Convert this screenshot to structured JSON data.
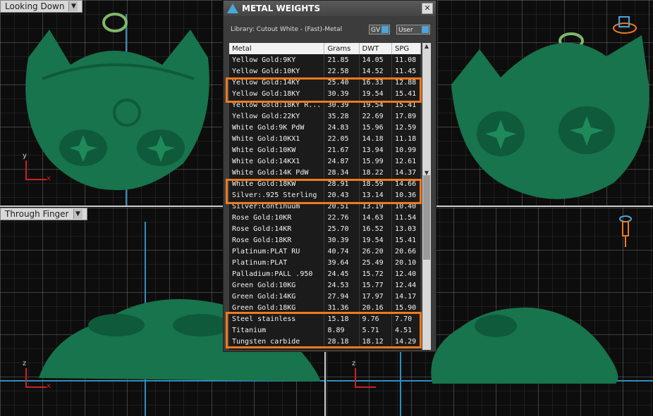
{
  "viewports": {
    "top_left": {
      "label": "Looking Down"
    },
    "bottom_left": {
      "label": "Through Finger"
    }
  },
  "panel": {
    "title": "METAL WEIGHTS",
    "library_label": "Library: Cutout White - (Fast)-Metal",
    "gv_label": "GV",
    "user_label": "User",
    "close_glyph": "✕"
  },
  "table": {
    "headers": [
      "Metal",
      "Grams",
      "DWT",
      "SPG"
    ],
    "rows": [
      [
        "Yellow Gold:9KY",
        "21.85",
        "14.05",
        "11.08"
      ],
      [
        "Yellow Gold:10KY",
        "22.58",
        "14.52",
        "11.45"
      ],
      [
        "Yellow Gold:14KY",
        "25.40",
        "16.33",
        "12.88"
      ],
      [
        "Yellow Gold:18KY",
        "30.39",
        "19.54",
        "15.41"
      ],
      [
        "Yellow Gold:18KY R...",
        "30.39",
        "19.54",
        "15.41"
      ],
      [
        "Yellow Gold:22KY",
        "35.28",
        "22.69",
        "17.89"
      ],
      [
        "White Gold:9K PdW",
        "24.83",
        "15.96",
        "12.59"
      ],
      [
        "White Gold:10KX1",
        "22.05",
        "14.18",
        "11.18"
      ],
      [
        "White Gold:10KW",
        "21.67",
        "13.94",
        "10.99"
      ],
      [
        "White Gold:14KX1",
        "24.87",
        "15.99",
        "12.61"
      ],
      [
        "White Gold:14K PdW",
        "28.34",
        "18.22",
        "14.37"
      ],
      [
        "White Gold:18KW",
        "28.91",
        "18.59",
        "14.66"
      ],
      [
        "Silver:.925 Sterling",
        "20.43",
        "13.14",
        "10.36"
      ],
      [
        "Silver:Continuum",
        "20.51",
        "13.19",
        "10.40"
      ],
      [
        "Rose Gold:10KR",
        "22.76",
        "14.63",
        "11.54"
      ],
      [
        "Rose Gold:14KR",
        "25.70",
        "16.52",
        "13.03"
      ],
      [
        "Rose Gold:18KR",
        "30.39",
        "19.54",
        "15.41"
      ],
      [
        "Platinum:PLAT RU",
        "40.74",
        "26.20",
        "20.66"
      ],
      [
        "Platinum:PLAT",
        "39.64",
        "25.49",
        "20.10"
      ],
      [
        "Palladium:PALL .950",
        "24.45",
        "15.72",
        "12.40"
      ],
      [
        "Green Gold:10KG",
        "24.53",
        "15.77",
        "12.44"
      ],
      [
        "Green Gold:14KG",
        "27.94",
        "17.97",
        "14.17"
      ],
      [
        "Green Gold:18KG",
        "31.36",
        "20.16",
        "15.90"
      ],
      [
        "Steel stainless",
        "15.18",
        "9.76",
        "7.70"
      ],
      [
        "Titanium",
        "8.89",
        "5.71",
        "4.51"
      ],
      [
        "Tungsten carbide",
        "28.18",
        "18.12",
        "14.29"
      ]
    ]
  },
  "axes": {
    "x": "x",
    "y": "y",
    "z": "z"
  },
  "colors": {
    "highlight": "#f07a1e",
    "model": "#1e8a5a",
    "axis": "#2f8fbf"
  }
}
